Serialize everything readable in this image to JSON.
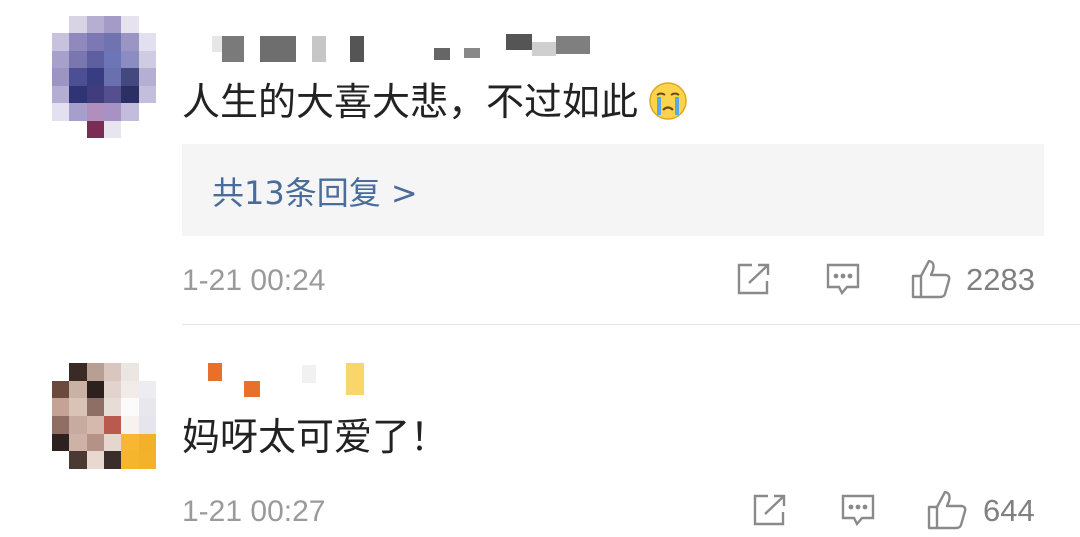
{
  "comments": [
    {
      "text": "人生的大喜大悲，不过如此",
      "emoji": "crying-face-emoji",
      "replies_label": "共13条回复 >",
      "time": "1-21 00:24",
      "likes": "2283",
      "icons": [
        "share-icon",
        "comment-icon",
        "like-icon"
      ]
    },
    {
      "text": "妈呀太可爱了！",
      "time": "1-21 00:27",
      "likes": "644",
      "icons": [
        "share-icon",
        "comment-icon",
        "like-icon"
      ]
    }
  ],
  "colors": {
    "reply_link": "#4a6c9a",
    "meta_text": "#9a9a9a",
    "reply_box_bg": "#f5f5f5"
  }
}
